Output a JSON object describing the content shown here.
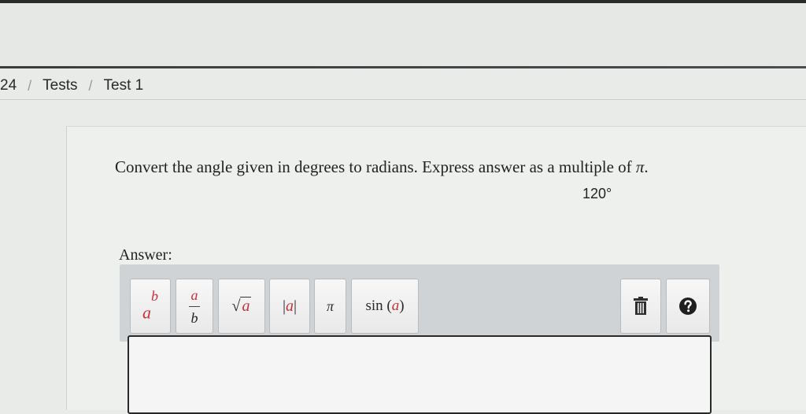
{
  "breadcrumb": {
    "items": [
      "24",
      "Tests",
      "Test 1"
    ],
    "separator": "/"
  },
  "question": {
    "prompt": "Convert the angle given in degrees to radians. Express answer as a multiple of ",
    "pi_symbol": "π",
    "prompt_end": ".",
    "given_value": "120°"
  },
  "answer": {
    "label": "Answer:",
    "value": ""
  },
  "toolbar": {
    "power": {
      "base": "a",
      "exp": "b",
      "icon": "power-icon"
    },
    "fraction": {
      "num": "a",
      "den": "b",
      "icon": "fraction-icon"
    },
    "sqrt": {
      "radical": "√",
      "arg": "a",
      "icon": "square-root-icon"
    },
    "abs": {
      "left": "|",
      "arg": "a",
      "right": "|",
      "icon": "absolute-value-icon"
    },
    "pi": {
      "label": "π",
      "icon": "pi-icon"
    },
    "sin": {
      "func": "sin",
      "open": "(",
      "arg": "a",
      "close": ")",
      "icon": "sine-icon"
    },
    "clear": {
      "icon": "trash-icon"
    },
    "help": {
      "icon": "help-icon"
    }
  },
  "colors": {
    "accent_red": "#c8323c",
    "toolbar_bg": "#cfd3d6",
    "top_rule": "#3a3d3d"
  }
}
